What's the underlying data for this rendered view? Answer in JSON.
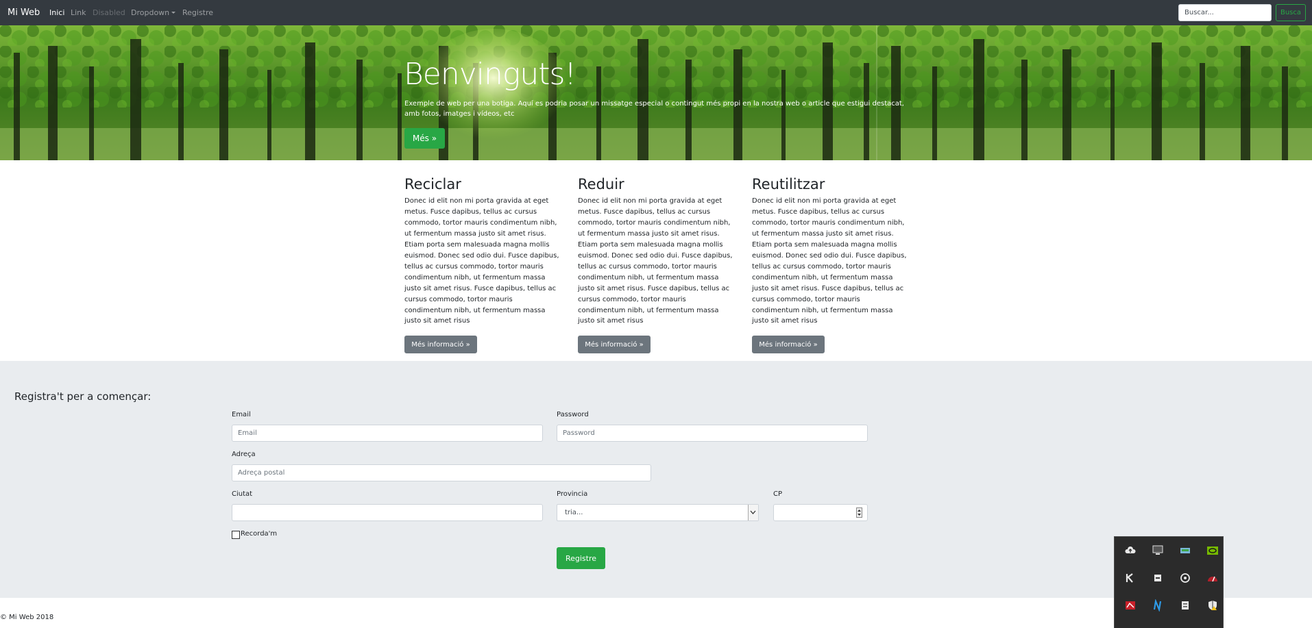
{
  "navbar": {
    "brand": "Mi Web",
    "links": [
      {
        "label": "Inici",
        "state": "active"
      },
      {
        "label": "Link",
        "state": "normal"
      },
      {
        "label": "Disabled",
        "state": "disabled"
      },
      {
        "label": "Dropdown",
        "state": "normal"
      },
      {
        "label": "Registre",
        "state": "normal"
      }
    ],
    "search_placeholder": "Buscar...",
    "search_button": "Busca"
  },
  "jumbotron": {
    "title": "Benvinguts!",
    "text": "Exemple de web per una botiga. Aquí es podria posar un missatge especial o contingut més propi en la nostra web o article que estigui destacat, amb fotos, imatges i vídeos, etc",
    "button": "Més »"
  },
  "columns": [
    {
      "title": "Reciclar",
      "text": "Donec id elit non mi porta gravida at eget metus. Fusce dapibus, tellus ac cursus commodo, tortor mauris condimentum nibh, ut fermentum massa justo sit amet risus. Etiam porta sem malesuada magna mollis euismod. Donec sed odio dui. Fusce dapibus, tellus ac cursus commodo, tortor mauris condimentum nibh, ut fermentum massa justo sit amet risus. Fusce dapibus, tellus ac cursus commodo, tortor mauris condimentum nibh, ut fermentum massa justo sit amet risus",
      "button": "Més informació »"
    },
    {
      "title": "Reduir",
      "text": "Donec id elit non mi porta gravida at eget metus. Fusce dapibus, tellus ac cursus commodo, tortor mauris condimentum nibh, ut fermentum massa justo sit amet risus. Etiam porta sem malesuada magna mollis euismod. Donec sed odio dui. Fusce dapibus, tellus ac cursus commodo, tortor mauris condimentum nibh, ut fermentum massa justo sit amet risus. Fusce dapibus, tellus ac cursus commodo, tortor mauris condimentum nibh, ut fermentum massa justo sit amet risus",
      "button": "Més informació »"
    },
    {
      "title": "Reutilitzar",
      "text": "Donec id elit non mi porta gravida at eget metus. Fusce dapibus, tellus ac cursus commodo, tortor mauris condimentum nibh, ut fermentum massa justo sit amet risus. Etiam porta sem malesuada magna mollis euismod. Donec sed odio dui. Fusce dapibus, tellus ac cursus commodo, tortor mauris condimentum nibh, ut fermentum massa justo sit amet risus. Fusce dapibus, tellus ac cursus commodo, tortor mauris condimentum nibh, ut fermentum massa justo sit amet risus",
      "button": "Més informació »"
    }
  ],
  "form": {
    "title": "Registra't per a començar:",
    "email_label": "Email",
    "email_placeholder": "Email",
    "password_label": "Password",
    "password_placeholder": "Password",
    "address_label": "Adreça",
    "address_placeholder": "Adreça postal",
    "city_label": "Ciutat",
    "province_label": "Provincia",
    "province_selected": "tria...",
    "cp_label": "CP",
    "remember_label": "Recorda'm",
    "submit": "Registre"
  },
  "footer": "© Mi Web 2018",
  "tray_icons": [
    "cloud-upload-icon",
    "monitor-icon",
    "network-card-icon",
    "nvidia-icon",
    "k-app-icon",
    "chip-icon",
    "steam-icon",
    "speedometer-icon",
    "redlion-icon",
    "n-app-icon",
    "storage-icon",
    "shield-warning-icon"
  ],
  "colors": {
    "navbar_bg": "#343a40",
    "success": "#28a745",
    "secondary": "#6c757d",
    "form_bg": "#e9ecef"
  }
}
